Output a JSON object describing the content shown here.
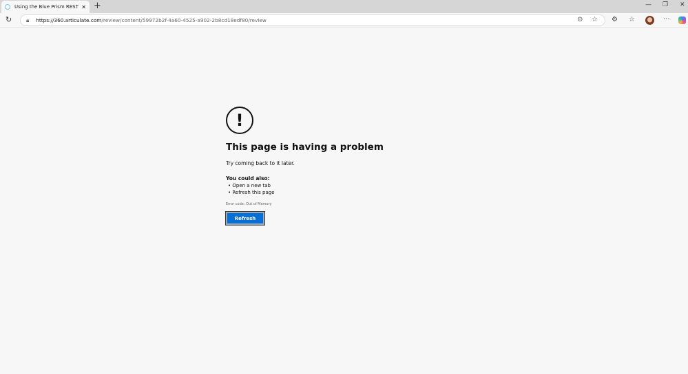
{
  "browser": {
    "tab_title": "Using the Blue Prism RESTful API",
    "url_host": "https://360.articulate.com",
    "url_path": "/review/content/59972b2f-4a60-4525-a902-2b8cd18edf80/review"
  },
  "error": {
    "title": "This page is having a problem",
    "message": "Try coming back to it later.",
    "could_also": "You could also:",
    "suggestions": [
      "Open a new tab",
      "Refresh this page"
    ],
    "error_code": "Error code: Out of Memory",
    "refresh_label": "Refresh"
  }
}
